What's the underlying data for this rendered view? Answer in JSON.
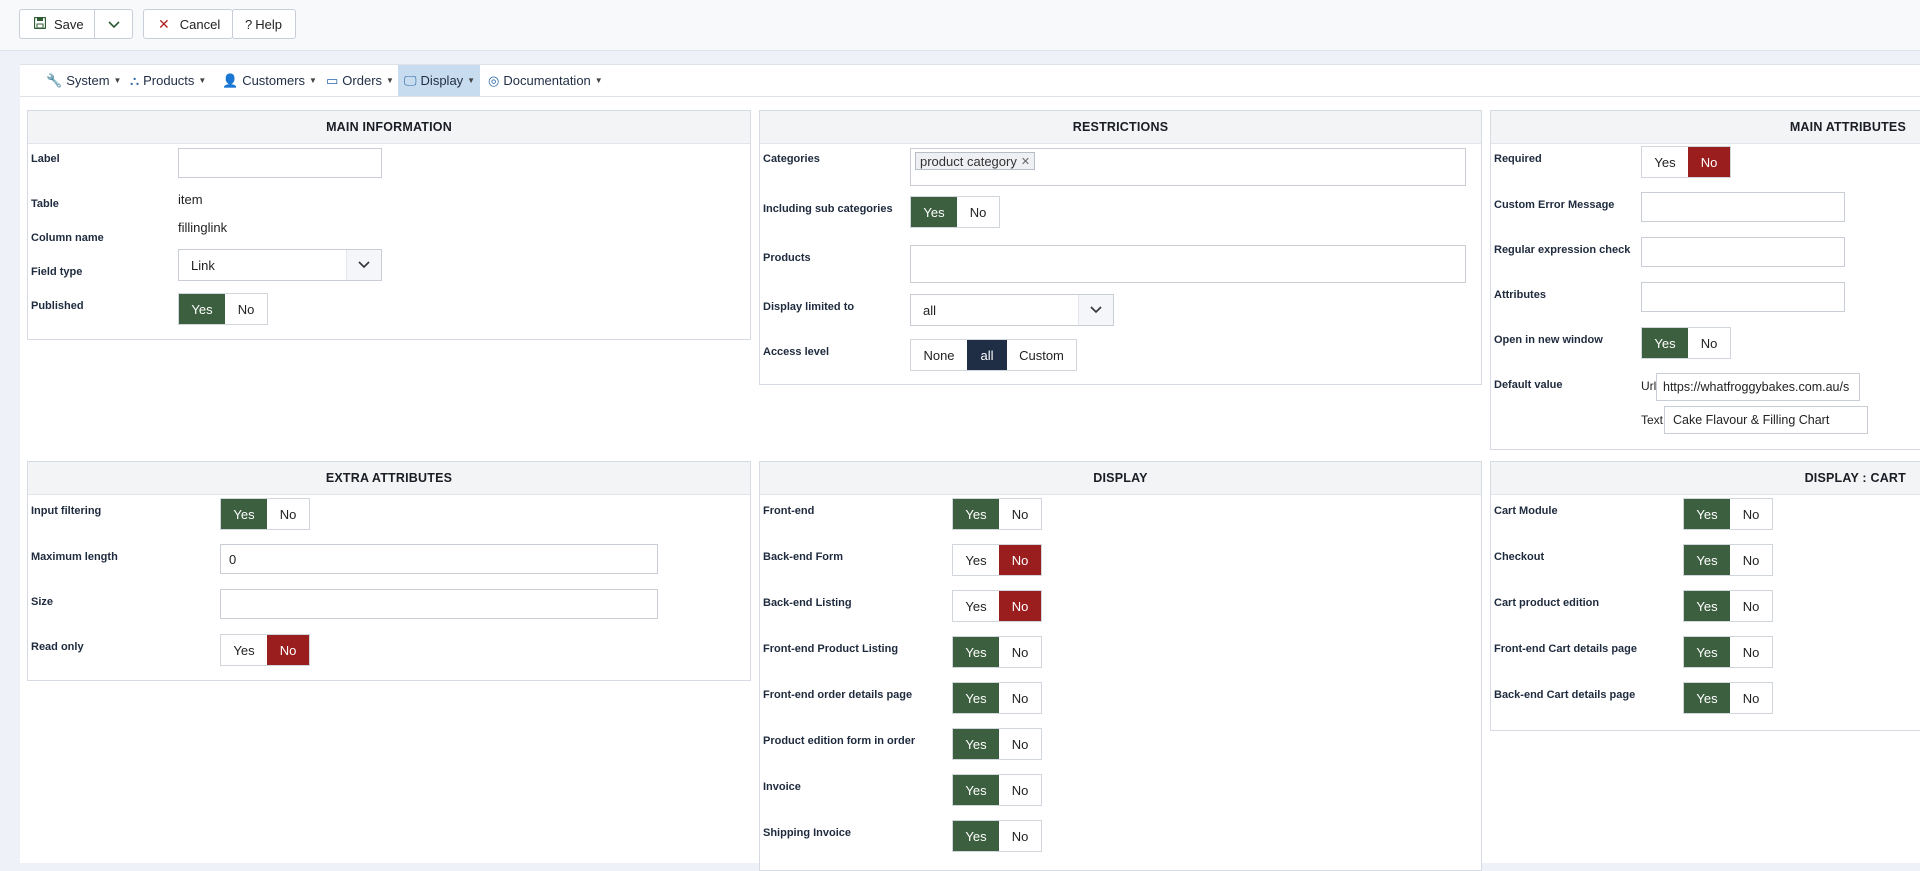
{
  "toolbar": {
    "save_label": "Save",
    "cancel_label": "Cancel",
    "help_label": "Help"
  },
  "menu": [
    {
      "label": "System"
    },
    {
      "label": "Products"
    },
    {
      "label": "Customers"
    },
    {
      "label": "Orders"
    },
    {
      "label": "Display"
    },
    {
      "label": "Documentation"
    }
  ],
  "main_information": {
    "title": "MAIN INFORMATION",
    "label_label": "Label",
    "label_value": "",
    "table_label": "Table",
    "table_value": "item",
    "column_label": "Column name",
    "column_value": "fillinglink",
    "fieldtype_label": "Field type",
    "fieldtype_value": "Link",
    "published_label": "Published",
    "published": "Yes"
  },
  "restrictions": {
    "title": "RESTRICTIONS",
    "categories_label": "Categories",
    "category_tag": "product category",
    "subcat_label": "Including sub categories",
    "subcat": "Yes",
    "products_label": "Products",
    "display_label": "Display limited to",
    "display_value": "all",
    "access_label": "Access level",
    "access_options": [
      "None",
      "all",
      "Custom"
    ],
    "access_selected": "all"
  },
  "main_attributes": {
    "title": "MAIN ATTRIBUTES",
    "required_label": "Required",
    "required": "No",
    "error_label": "Custom Error Message",
    "regex_label": "Regular expression check",
    "attributes_label": "Attributes",
    "newwindow_label": "Open in new window",
    "newwindow": "Yes",
    "default_label": "Default value",
    "url_label": "Url",
    "url_value": "https://whatfroggybakes.com.au/s",
    "text_label": "Text",
    "text_value": "Cake Flavour & Filling Chart"
  },
  "extra_attributes": {
    "title": "EXTRA ATTRIBUTES",
    "filter_label": "Input filtering",
    "filter": "Yes",
    "maxlen_label": "Maximum length",
    "maxlen_value": "0",
    "size_label": "Size",
    "readonly_label": "Read only",
    "readonly": "No"
  },
  "display": {
    "title": "DISPLAY",
    "rows": [
      {
        "label": "Front-end",
        "value": "Yes"
      },
      {
        "label": "Back-end Form",
        "value": "No"
      },
      {
        "label": "Back-end Listing",
        "value": "No"
      },
      {
        "label": "Front-end Product Listing",
        "value": "Yes"
      },
      {
        "label": "Front-end order details page",
        "value": "Yes"
      },
      {
        "label": "Product edition form in order",
        "value": "Yes"
      },
      {
        "label": "Invoice",
        "value": "Yes"
      },
      {
        "label": "Shipping Invoice",
        "value": "Yes"
      }
    ]
  },
  "display_cart": {
    "title": "DISPLAY : CART",
    "rows": [
      {
        "label": "Cart Module",
        "value": "Yes"
      },
      {
        "label": "Checkout",
        "value": "Yes"
      },
      {
        "label": "Cart product edition",
        "value": "Yes"
      },
      {
        "label": "Front-end Cart details page",
        "value": "Yes"
      },
      {
        "label": "Back-end Cart details page",
        "value": "Yes"
      }
    ]
  },
  "common": {
    "yes": "Yes",
    "no": "No"
  },
  "colors": {
    "yes_on": "#3c5f3f",
    "no_on": "#9a1e1e",
    "selected": "#1f2d45",
    "menu_active": "#c8dcf0"
  },
  "icons": [
    "save-icon",
    "chevron-down-icon",
    "close-icon",
    "help-icon",
    "wrench-icon",
    "cubes-icon",
    "user-icon",
    "orders-icon",
    "monitor-icon",
    "lifebuoy-icon"
  ]
}
